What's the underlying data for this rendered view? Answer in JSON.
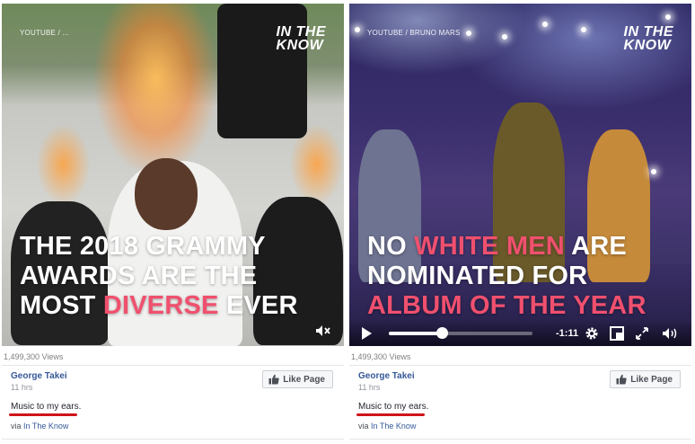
{
  "posts": [
    {
      "video": {
        "source": "YOUTUBE / ...",
        "brand_line1": "IN THE",
        "brand_line2": "KNOW",
        "caption_line1": "THE 2018 GRAMMY",
        "caption_line2": "AWARDS ARE THE",
        "caption_line3_pre": "MOST ",
        "caption_line3_hl": "DIVERSE",
        "caption_line3_post": " EVER"
      },
      "views": "1,499,300 Views",
      "page_name": "George Takei",
      "time_ago": "11 hrs",
      "text": "Music to my ears.",
      "via_prefix": "via ",
      "via_link": "In The Know",
      "like_label": "Like Page"
    },
    {
      "video": {
        "source": "YOUTUBE / BRUNO MARS",
        "brand_line1": "IN THE",
        "brand_line2": "KNOW",
        "caption_line1_pre": "NO ",
        "caption_line1_hl": "WHITE MEN",
        "caption_line1_post": " ARE",
        "caption_line2": "NOMINATED FOR",
        "caption_line3_hl": "ALBUM OF THE YEAR",
        "time_remaining": "-1:11",
        "progress": 0.37
      },
      "views": "1,499,300 Views",
      "page_name": "George Takei",
      "time_ago": "11 hrs",
      "text": "Music to my ears.",
      "via_prefix": "via ",
      "via_link": "In The Know",
      "like_label": "Like Page"
    }
  ],
  "colors": {
    "highlight": "#f0506e",
    "link": "#365899",
    "underline_mark": "#d0151a"
  },
  "icons": [
    "mute-icon",
    "play-icon",
    "gear-icon",
    "pip-icon",
    "fullscreen-icon",
    "volume-icon",
    "thumbs-up-icon"
  ]
}
